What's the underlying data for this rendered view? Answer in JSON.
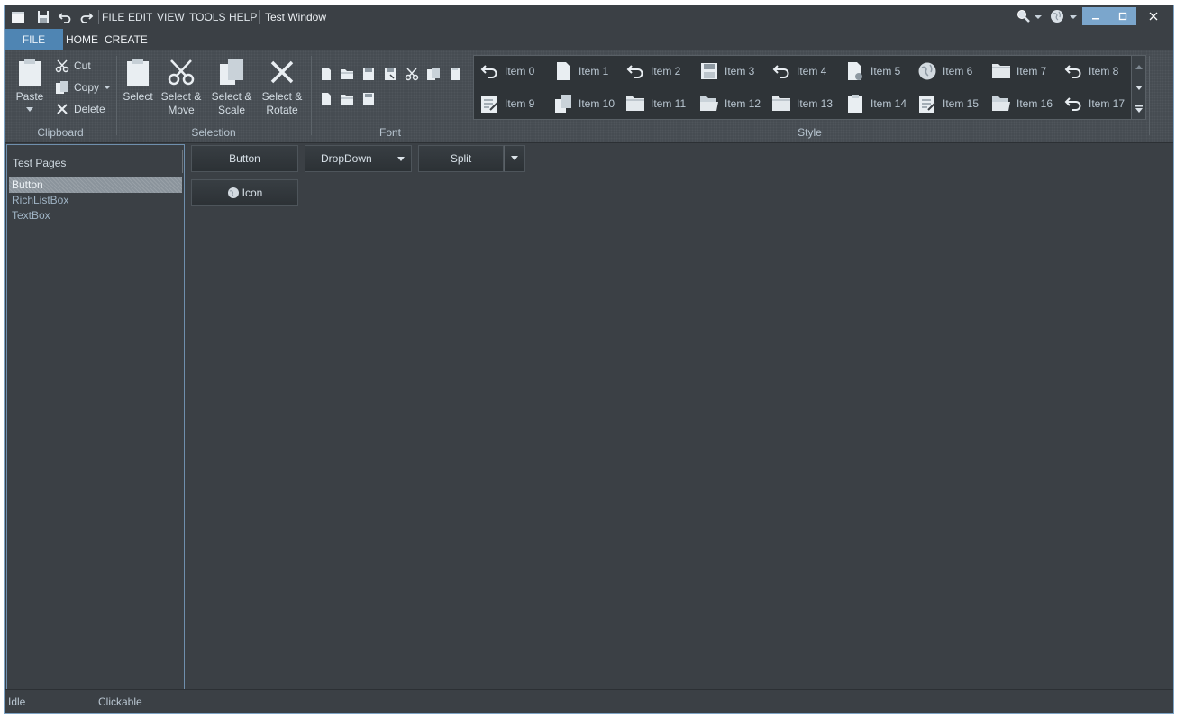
{
  "titlebar": {
    "menus": [
      "FILE",
      "EDIT",
      "VIEW",
      "TOOLS",
      "HELP"
    ],
    "title": "Test Window"
  },
  "ribbon_tabs": {
    "file": "FILE",
    "home": "HOME",
    "create": "CREATE"
  },
  "clipboard": {
    "paste": "Paste",
    "cut": "Cut",
    "copy": "Copy",
    "delete": "Delete",
    "label": "Clipboard"
  },
  "selection": {
    "select": "Select",
    "select_move_1": "Select &",
    "select_move_2": "Move",
    "select_scale_1": "Select &",
    "select_scale_2": "Scale",
    "select_rotate_1": "Select &",
    "select_rotate_2": "Rotate",
    "label": "Selection"
  },
  "font": {
    "label": "Font"
  },
  "style": {
    "label": "Style",
    "items": [
      {
        "label": "Item 0",
        "icon": "undo-icon"
      },
      {
        "label": "Item 1",
        "icon": "document-icon"
      },
      {
        "label": "Item 2",
        "icon": "undo-icon"
      },
      {
        "label": "Item 3",
        "icon": "save-icon"
      },
      {
        "label": "Item 4",
        "icon": "undo-icon"
      },
      {
        "label": "Item 5",
        "icon": "document-settings-icon"
      },
      {
        "label": "Item 6",
        "icon": "globe-icon"
      },
      {
        "label": "Item 7",
        "icon": "folder-icon"
      },
      {
        "label": "Item 8",
        "icon": "undo-icon"
      },
      {
        "label": "Item 9",
        "icon": "edit-document-icon"
      },
      {
        "label": "Item 10",
        "icon": "copy-icon"
      },
      {
        "label": "Item 11",
        "icon": "folder-icon"
      },
      {
        "label": "Item 12",
        "icon": "open-folder-icon"
      },
      {
        "label": "Item 13",
        "icon": "folder-icon"
      },
      {
        "label": "Item 14",
        "icon": "clipboard-icon"
      },
      {
        "label": "Item 15",
        "icon": "edit-document-icon"
      },
      {
        "label": "Item 16",
        "icon": "open-folder-icon"
      },
      {
        "label": "Item 17",
        "icon": "undo-icon"
      }
    ]
  },
  "left_panel": {
    "header": "Test Pages",
    "items": [
      "Button",
      "RichListBox",
      "TextBox"
    ],
    "selected": "Button"
  },
  "content": {
    "button": "Button",
    "dropdown": "DropDown",
    "split": "Split",
    "icon_button": "Icon"
  },
  "status": {
    "left": "Idle",
    "right": "Clickable"
  },
  "colors": {
    "accent": "#4f85b3",
    "background": "#3b4045",
    "ribbon": "#464c52"
  }
}
